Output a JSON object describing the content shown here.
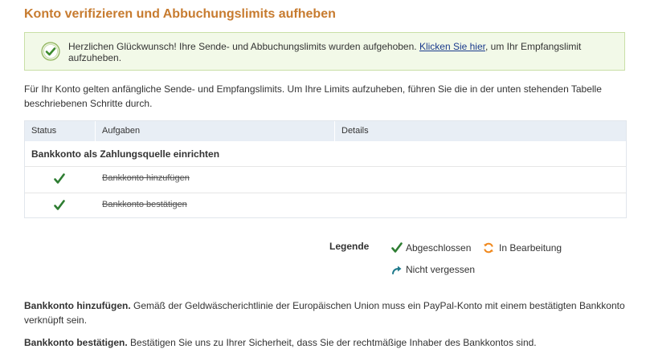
{
  "page_title": "Konto verifizieren und Abbuchungslimits aufheben",
  "success": {
    "text_before": "Herzlichen Glückwunsch! Ihre Sende- und Abbuchungslimits wurden aufgehoben.",
    "link": "Klicken Sie hier",
    "text_after": ", um Ihr Empfangslimit aufzuheben."
  },
  "intro": "Für Ihr Konto gelten anfängliche Sende- und Empfangslimits. Um Ihre Limits aufzuheben, führen Sie die in der unten stehenden Tabelle beschriebenen Schritte durch.",
  "table": {
    "headers": [
      "Status",
      "Aufgaben",
      "Details"
    ],
    "group_title": "Bankkonto als Zahlungsquelle einrichten",
    "rows": [
      {
        "task": "Bankkonto hinzufügen",
        "status": "Abgeschlossen"
      },
      {
        "task": "Bankkonto bestätigen",
        "status": "Abgeschlossen"
      }
    ]
  },
  "legend": {
    "title": "Legende",
    "completed": "Abgeschlossen",
    "in_progress": "In Bearbeitung",
    "dont_forget": "Nicht vergessen"
  },
  "descriptions": [
    {
      "title": "Bankkonto hinzufügen.",
      "text": "Gemäß der Geldwäscherichtlinie der Europäischen Union muss ein PayPal-Konto mit einem bestätigten Bankkonto verknüpft sein."
    },
    {
      "title": "Bankkonto bestätigen.",
      "text": "Bestätigen Sie uns zu Ihrer Sicherheit, dass Sie der rechtmäßige Inhaber des Bankkontos sind."
    }
  ],
  "colors": {
    "title": "#c77b2f",
    "check": "#2e7d32",
    "progress": "#f0891e",
    "arrow": "#1f7a8c",
    "link": "#1a3a8c"
  }
}
